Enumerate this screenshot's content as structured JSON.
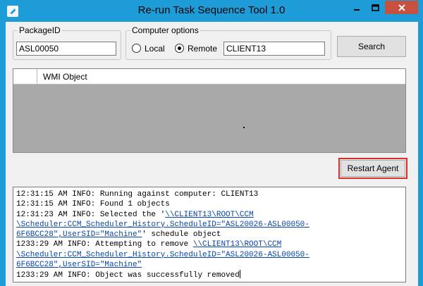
{
  "window": {
    "title": "Re-run Task Sequence Tool 1.0"
  },
  "package": {
    "label": "PackageID",
    "value": "ASL00050"
  },
  "computer": {
    "label": "Computer options",
    "local_label": "Local",
    "remote_label": "Remote",
    "selected": "Remote",
    "name_value": "CLIENT13"
  },
  "buttons": {
    "search": "Search",
    "restart_agent": "Restart Agent"
  },
  "grid": {
    "column": "WMI Object"
  },
  "log": {
    "line1": "12:31:15 AM INFO: Running against computer: CLIENT13",
    "line2": "12:31:15 AM INFO: Found 1 objects",
    "line3_pre": "12:31:23 AM INFO: Selected the '",
    "line3_link": "\\\\CLIENT13\\ROOT\\CCM",
    "line4_link": "\\Scheduler:CCM_Scheduler_History.ScheduleID=\"ASL20026-ASL00050-",
    "line5_link": "6F6BCC28\",UserSID=\"Machine\"",
    "line5_post": "' schedule object",
    "line6_pre": "1233:29 AM INFO: Attempting to remove ",
    "line6_link": "\\\\CLIENT13\\ROOT\\CCM",
    "line7_link": "\\Scheduler:CCM_Scheduler_History.ScheduleID=\"ASL20026-ASL00050-",
    "line8_link": "6F6BCC28\",UserSID=\"Machine\"",
    "line9": "1233:29 AM INFO: Object was successfully removed"
  },
  "icons": {
    "app": "app-icon",
    "minimize": "minimize-icon",
    "maximize": "maximize-icon",
    "close": "close-icon"
  },
  "colors": {
    "chrome": "#1e9cd7",
    "close": "#c7503f",
    "highlight": "#d9302c",
    "link": "#0645ad"
  }
}
